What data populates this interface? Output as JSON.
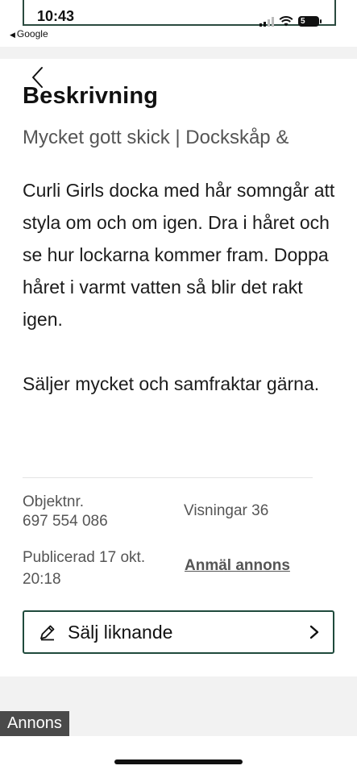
{
  "status_bar": {
    "time": "10:43",
    "back_app": "Google",
    "battery": "5"
  },
  "listing": {
    "heading": "Beskrivning",
    "subtitle": "Mycket gott skick | Dockskåp &",
    "description": [
      "Curli Girls docka med hår somngår att styla om och om igen. Dra i håret och se hur lockarna kommer fram. Doppa håret i varmt vatten så blir det rakt igen.",
      "Säljer mycket och samfraktar gärna."
    ],
    "object_label": "Objektnr.",
    "object_number": "697 554 086",
    "views": "Visningar 36",
    "published": "Publicerad 17 okt. 20:18",
    "report_link": "Anmäl annons",
    "sell_similar": "Sälj liknande"
  },
  "ad": {
    "badge": "Annons"
  },
  "colors": {
    "accent_green": "#1f4a3c",
    "card_bg": "#ffffff",
    "page_bg": "#f2f2f2",
    "ad_badge_bg": "#4a4a4a"
  },
  "icons": [
    "signal-icon",
    "wifi-icon",
    "battery-icon",
    "back-chevron-icon",
    "pencil-icon",
    "chevron-right-icon"
  ]
}
